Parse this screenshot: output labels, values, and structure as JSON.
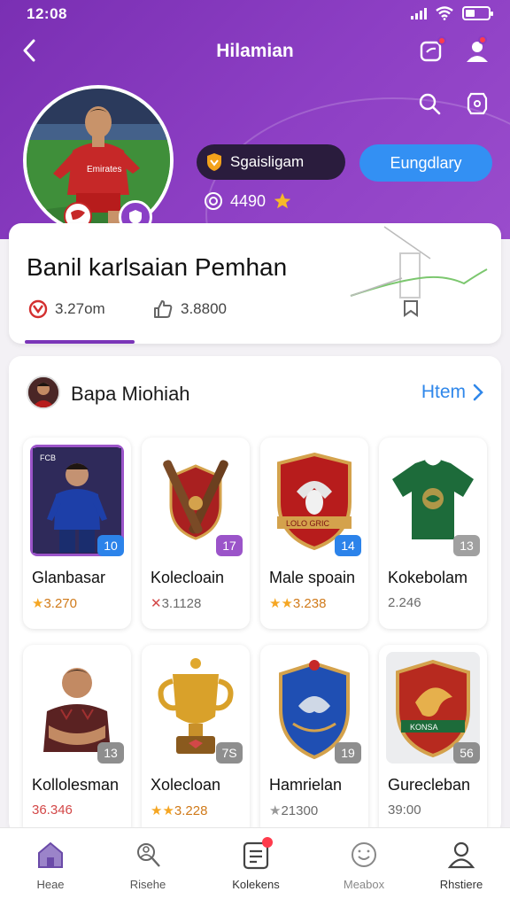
{
  "status": {
    "time": "12:08"
  },
  "header": {
    "title": "Hilamian"
  },
  "profile": {
    "league_label": "Sgaisligam",
    "follow_label": "Eungdlary",
    "points": "4490",
    "name": "Banil karlsaian Pemhan",
    "stat_views": "3.27om",
    "stat_likes": "3.8800"
  },
  "collection": {
    "title": "Bapa Miohiah",
    "link_label": "Htem",
    "items": [
      {
        "name": "Glanbasar",
        "price": "3.270",
        "count": "10",
        "count_color": "#2c83ea",
        "price_color": "#d07a1a"
      },
      {
        "name": "Kolecloain",
        "price": "3.1128",
        "count": "17",
        "count_color": "#9b54c9",
        "price_color": "#6a6a6a"
      },
      {
        "name": "Male spoain",
        "price": "3.238",
        "count": "14",
        "count_color": "#2c83ea",
        "price_color": "#d07a1a"
      },
      {
        "name": "Kokebolam",
        "price": "2.246",
        "count": "13",
        "count_color": "#a0a0a0",
        "price_color": "#6a6a6a"
      },
      {
        "name": "Kollolesman",
        "price": "36.346",
        "count": "13",
        "count_color": "#8e8e8e",
        "price_color": "#d34848"
      },
      {
        "name": "Xolecloan",
        "price": "3.228",
        "count": "7S",
        "count_color": "#8e8e8e",
        "price_color": "#d07a1a"
      },
      {
        "name": "Hamrielan",
        "price": "21300",
        "count": "19",
        "count_color": "#8e8e8e",
        "price_color": "#6a6a6a"
      },
      {
        "name": "Gurecleban",
        "price": "39:00",
        "count": "56",
        "count_color": "#8e8e8e",
        "price_color": "#6a6a6a"
      }
    ]
  },
  "nav": [
    {
      "label": "Heae",
      "icon": "home-icon"
    },
    {
      "label": "Risehe",
      "icon": "search-person-icon"
    },
    {
      "label": "Kolekens",
      "icon": "list-icon"
    },
    {
      "label": "Meabox",
      "icon": "smile-icon"
    },
    {
      "label": "Rhstiere",
      "icon": "person-icon"
    }
  ],
  "colors": {
    "header": "#8a3cc1",
    "accent": "#3390f3",
    "tab": "#7a35b8"
  }
}
